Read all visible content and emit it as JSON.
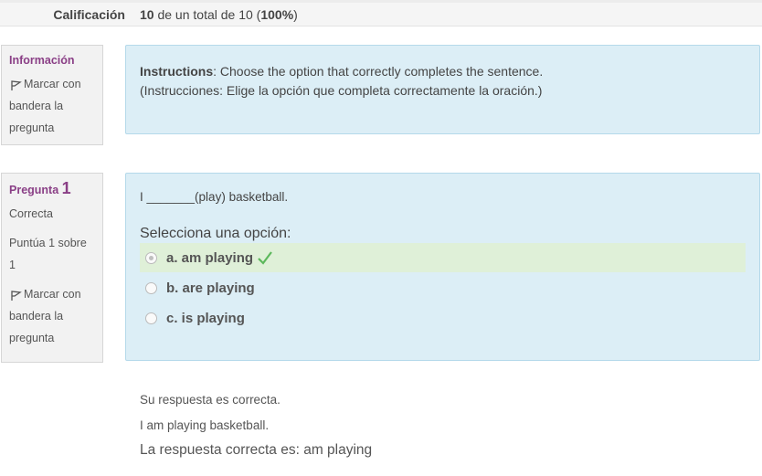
{
  "grade": {
    "label": "Calificación",
    "score": "10",
    "text_mid": " de un total de 10 (",
    "percent": "100%",
    "text_end": ")"
  },
  "info_block": {
    "title": "Información",
    "flag_label": "Marcar con bandera la pregunta",
    "instructions_label": "Instructions",
    "instructions_text": ": Choose the option that correctly completes the sentence.",
    "instructions_translation": "(Instrucciones: Elige la opción que completa correctamente la oración.)"
  },
  "question": {
    "prefix": "Pregunta",
    "number": "1",
    "status": "Correcta",
    "score": "Puntúa 1 sobre 1",
    "flag_label": "Marcar con bandera la pregunta",
    "text": "I _______(play) basketball.",
    "prompt": "Selecciona una opción:",
    "options": [
      {
        "label": "a. am playing",
        "selected": true,
        "correct": true
      },
      {
        "label": "b. are playing",
        "selected": false,
        "correct": false
      },
      {
        "label": "c. is playing",
        "selected": false,
        "correct": false
      }
    ]
  },
  "feedback": {
    "result": "Su respuesta es correcta.",
    "sentence": "I am playing basketball.",
    "correct_answer": "La respuesta correcta es: am playing"
  },
  "colors": {
    "accent": "#8a3f86",
    "content_bg": "#dceef6",
    "correct_bg": "#dff0d8",
    "check": "#5cb85c"
  }
}
